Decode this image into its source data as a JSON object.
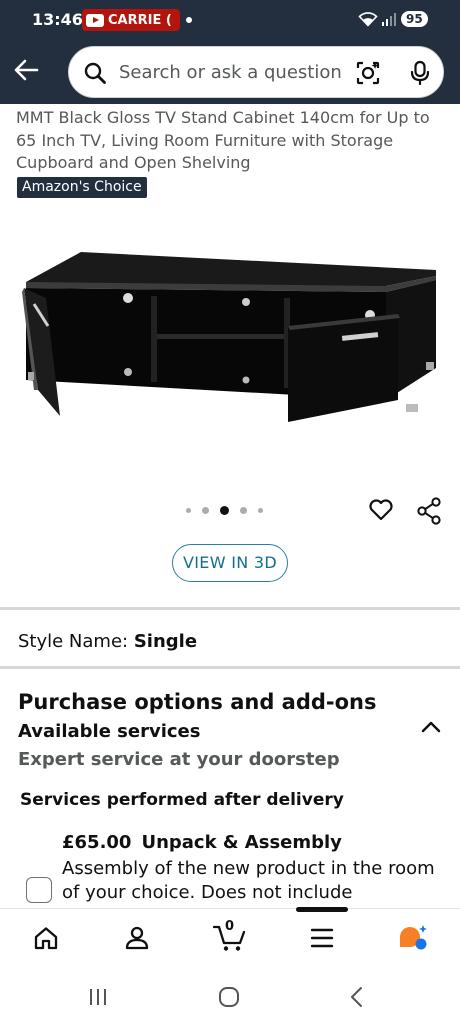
{
  "status_bar": {
    "time": "13:46",
    "notification_label": "CARRIE (",
    "battery": "95",
    "icons": [
      "youtube-icon",
      "wifi-icon",
      "signal-icon"
    ]
  },
  "header": {
    "back_icon": "back-arrow-icon",
    "search_placeholder": "Search or ask a question",
    "camera_icon": "camera-lens-icon",
    "mic_icon": "microphone-icon"
  },
  "product": {
    "title": "MMT Black Gloss TV Stand Cabinet 140cm for Up to 65 Inch TV, Living Room Furniture with Storage Cupboard and Open Shelving",
    "badge": "Amazon's Choice",
    "image_alt": "black-gloss-tv-stand-image",
    "carousel_active_index": 2,
    "carousel_count": 5,
    "view_3d_label": "VIEW IN 3D"
  },
  "style": {
    "label": "Style Name:",
    "value": "Single"
  },
  "purchase": {
    "section_title": "Purchase options and add-ons",
    "services_label": "Available services",
    "expert_text": "Expert service at your doorstep",
    "after_delivery": "Services performed after delivery",
    "service": {
      "price": "£65.00",
      "name": "Unpack & Assembly",
      "description": "Assembly of the new product in the room of your choice. Does not include",
      "checked": false
    }
  },
  "bottom_nav": {
    "items": [
      "home-icon",
      "account-icon",
      "cart-icon",
      "menu-icon",
      "rufus-ai-icon"
    ],
    "cart_count": "0"
  },
  "colors": {
    "header_bg": "#232f3e",
    "link_teal": "#146e8f",
    "badge_bg": "#232f3e",
    "text_primary": "#0f1111",
    "text_secondary": "#565959",
    "notification_red": "#b3140c",
    "ai_orange": "#f77f26",
    "ai_blue": "#1a73e8"
  }
}
